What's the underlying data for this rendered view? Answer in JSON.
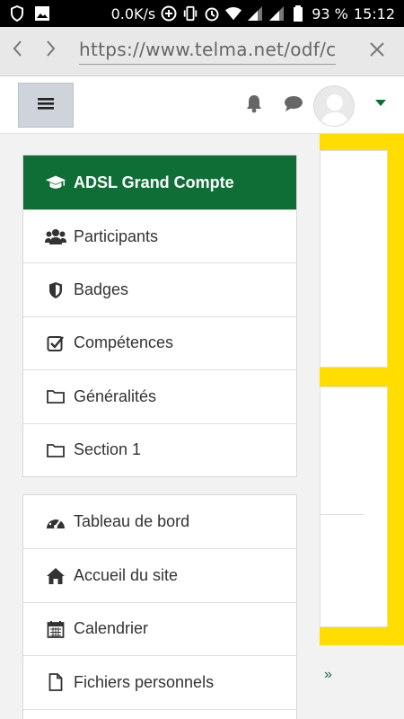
{
  "status_bar": {
    "speed": "0.0K/s",
    "battery": "93 %",
    "time": "15:12",
    "icons": [
      "shield-icon",
      "image-icon",
      "plus-circle-icon",
      "vibrate-icon",
      "alarm-icon",
      "wifi-icon",
      "signal-icon",
      "signal-icon",
      "battery-icon"
    ]
  },
  "browser": {
    "url": "https://www.telma.net/odf/c",
    "back_icon": "chevron-left-icon",
    "forward_icon": "chevron-right-icon",
    "close_icon": "close-icon"
  },
  "navbar": {
    "menu_icon": "hamburger-icon",
    "notification_icon": "bell-icon",
    "messages_icon": "chat-icon",
    "avatar_icon": "user-avatar-icon",
    "user_menu_icon": "caret-down-icon"
  },
  "drawer": {
    "course_items": [
      {
        "label": "ADSL Grand Compte",
        "icon": "graduation-cap-icon",
        "active": true
      },
      {
        "label": "Participants",
        "icon": "users-icon"
      },
      {
        "label": "Badges",
        "icon": "shield-badge-icon"
      },
      {
        "label": "Compétences",
        "icon": "checkbox-icon"
      },
      {
        "label": "Généralités",
        "icon": "folder-icon"
      },
      {
        "label": "Section 1",
        "icon": "folder-icon"
      }
    ],
    "site_items": [
      {
        "label": "Tableau de bord",
        "icon": "dashboard-icon"
      },
      {
        "label": "Accueil du site",
        "icon": "home-icon"
      },
      {
        "label": "Calendrier",
        "icon": "calendar-icon"
      },
      {
        "label": "Fichiers personnels",
        "icon": "file-icon"
      }
    ]
  },
  "content": {
    "more_link": "»"
  },
  "colors": {
    "accent": "#0f6e36",
    "highlight_yellow": "#ffdd00",
    "menu_button_bg": "#ced4da"
  }
}
